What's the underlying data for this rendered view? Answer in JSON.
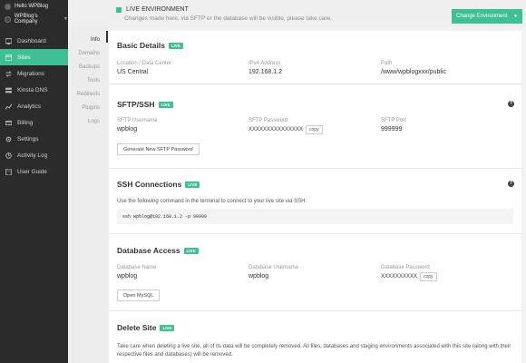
{
  "sidebar": {
    "greeting": "Hello WPBlog",
    "company": "WPBlog's Company",
    "items": [
      {
        "label": "Dashboard",
        "icon": "dashboard-icon",
        "active": false
      },
      {
        "label": "Sites",
        "icon": "sites-icon",
        "active": true
      },
      {
        "label": "Migrations",
        "icon": "migrations-icon",
        "active": false
      },
      {
        "label": "Kinsta DNS",
        "icon": "dns-icon",
        "active": false
      },
      {
        "label": "Analytics",
        "icon": "analytics-icon",
        "active": false
      },
      {
        "label": "Billing",
        "icon": "billing-icon",
        "active": false
      },
      {
        "label": "Settings",
        "icon": "settings-icon",
        "active": false
      },
      {
        "label": "Activity Log",
        "icon": "activity-icon",
        "active": false
      },
      {
        "label": "User Guide",
        "icon": "guide-icon",
        "active": false
      }
    ]
  },
  "header": {
    "env_title": "LIVE ENVIRONMENT",
    "env_subtitle": "Changes made here, via SFTP or the database will be visible, please take care.",
    "change_env_label": "Change Environment"
  },
  "subnav": {
    "items": [
      "Info",
      "Domains",
      "Backups",
      "Tools",
      "Redirects",
      "Plugins",
      "Logs"
    ],
    "active": "Info"
  },
  "live_badge": "LIVE",
  "basic": {
    "title": "Basic Details",
    "location_label": "Location / Data Center",
    "location_value": "US Central",
    "ip_label": "IPv4 Address",
    "ip_value": "192.168.1.2",
    "path_label": "Path",
    "path_value": "/www/wpblogxxx/public"
  },
  "sftp": {
    "title": "SFTP/SSH",
    "username_label": "SFTP Username",
    "username_value": "wpblog",
    "password_label": "SFTP Password",
    "password_value": "XXXXXXXXXXXXXXX",
    "copy_label": "copy",
    "port_label": "SFTP Port",
    "port_value": "999999",
    "generate_label": "Generate New SFTP Password"
  },
  "ssh": {
    "title": "SSH Connections",
    "instructions": "Use the following command in the terminal to connect to your live site via SSH:",
    "command": "ssh wpblog@192.168.1.2 -p 99999"
  },
  "database": {
    "title": "Database Access",
    "name_label": "Database Name",
    "name_value": "wpblog",
    "user_label": "Database Username",
    "user_value": "wpblog",
    "password_label": "Database Password",
    "password_value": "XXXXXXXXXX",
    "copy_label": "copy",
    "open_label": "Open MySQL"
  },
  "delete": {
    "title": "Delete Site",
    "warning": "Take care when deleting a live site, all of its data will be completely removed. All files, databases and staging environments associated with this site (along with their respective files and databases) will be removed."
  },
  "colors": {
    "accent": "#3fbf95",
    "sidebar_bg": "#2b2b2b"
  }
}
